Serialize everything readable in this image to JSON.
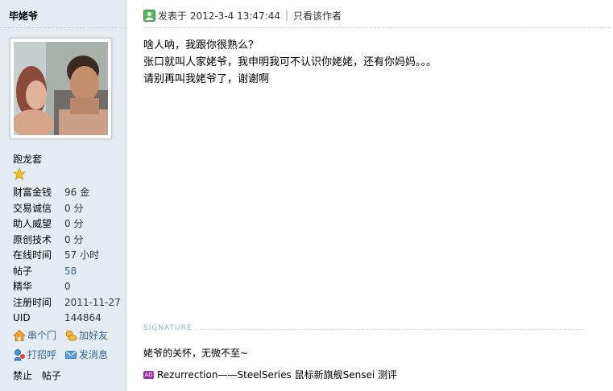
{
  "author": {
    "name": "毕姥爷",
    "group": "跑龙套",
    "stats": [
      {
        "label": "财富金钱",
        "value": "96 金"
      },
      {
        "label": "交易诚信",
        "value": "0 分"
      },
      {
        "label": "助人威望",
        "value": "0 分"
      },
      {
        "label": "原创技术",
        "value": "0 分"
      },
      {
        "label": "在线时间",
        "value": "57 小时"
      },
      {
        "label": "帖子",
        "value": "58"
      },
      {
        "label": "精华",
        "value": "0"
      },
      {
        "label": "注册时间",
        "value": "2011-11-27"
      },
      {
        "label": "UID",
        "value": "144864"
      }
    ],
    "actions": {
      "visit": "串个门",
      "add_friend": "加好友",
      "poke": "打招呼",
      "message": "发消息"
    },
    "footer": {
      "ban": "禁止",
      "posts": "帖子"
    }
  },
  "post": {
    "posted_at": "发表于 2012-3-4 13:47:44",
    "only_author": "只看该作者",
    "lines": [
      "啥人呐，我跟你很熟么？",
      "张口就叫人家姥爷，我申明我可不认识你姥姥，还有你妈妈。。。",
      "请别再叫我姥爷了，谢谢啊"
    ]
  },
  "signature": {
    "label": "SIGNATURE",
    "text": "姥爷的关怀，无微不至~"
  },
  "ad": {
    "badge": "AD",
    "text": "Rezurrection——SteelSeries 鼠标新旗舰Sensei 测评"
  },
  "colors": {
    "sidebar_bg": "#e5edf2",
    "link": "#336699",
    "divider": "#c2d5e3"
  }
}
